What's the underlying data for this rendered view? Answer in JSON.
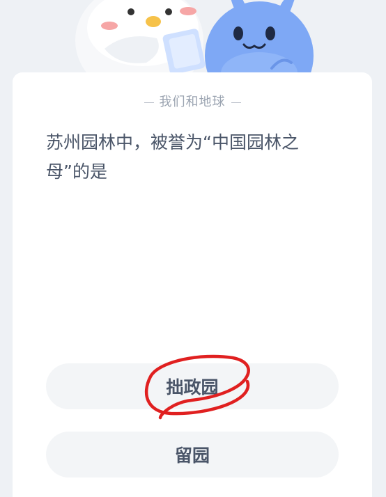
{
  "quiz": {
    "category": "我们和地球",
    "question": "苏州园林中，被誉为“中国园林之母”的是",
    "options": [
      {
        "label": "拙政园"
      },
      {
        "label": "留园"
      }
    ]
  },
  "colors": {
    "background": "#eef1f5",
    "card": "#ffffff",
    "text": "#4a5568",
    "muted": "#9aa3b0",
    "option_bg": "#f3f5f7",
    "annotation": "#e02020",
    "mascot_blue": "#7ea8f5"
  },
  "icons": {
    "left_mascot": "white-bird-mascot",
    "right_mascot": "blue-rabbit-mascot"
  }
}
